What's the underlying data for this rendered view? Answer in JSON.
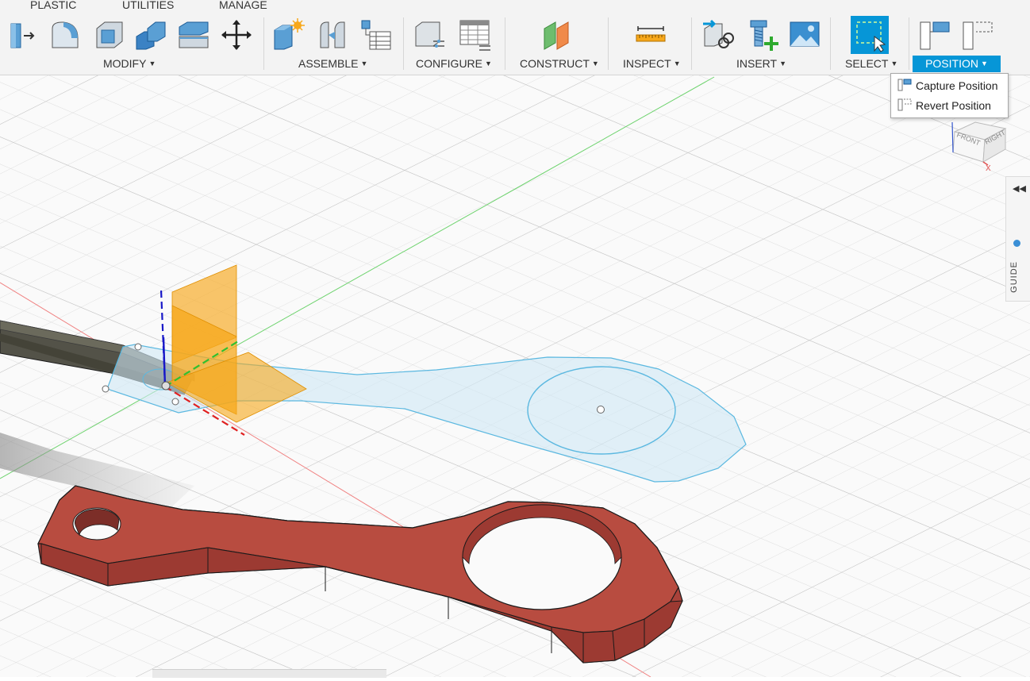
{
  "tabs": [
    "PLASTIC",
    "UTILITIES",
    "MANAGE"
  ],
  "groups": {
    "modify": "MODIFY",
    "assemble": "ASSEMBLE",
    "configure": "CONFIGURE",
    "construct": "CONSTRUCT",
    "inspect": "INSPECT",
    "insert": "INSERT",
    "select": "SELECT",
    "position": "POSITION"
  },
  "position_menu": {
    "capture": "Capture Position",
    "revert": "Revert Position"
  },
  "viewcube": {
    "front": "FRONT",
    "right": "RIGHT",
    "axis_x": "X"
  },
  "guide_panel": {
    "label": "GUIDE"
  },
  "colors": {
    "accent": "#0696d7",
    "part": "#b04a3c",
    "sketch_fill": "#cfe8f5",
    "sketch_line": "#5bb8e0",
    "plane": "#f7a81b",
    "grid": "#d8d8d8"
  },
  "icons": {
    "modify": [
      "press-pull-icon",
      "fillet-icon",
      "shell-icon",
      "combine-icon",
      "offset-face-icon",
      "move-icon"
    ],
    "assemble": [
      "new-component-icon",
      "joint-icon",
      "component-table-icon"
    ],
    "configure": [
      "configure-icon",
      "configure-table-icon"
    ],
    "construct": [
      "offset-plane-icon"
    ],
    "inspect": [
      "measure-icon"
    ],
    "insert": [
      "insert-derive-icon",
      "insert-mcmaster-icon",
      "insert-canvas-icon"
    ],
    "select": [
      "window-select-icon"
    ],
    "position": [
      "capture-position-icon",
      "revert-position-icon"
    ]
  }
}
